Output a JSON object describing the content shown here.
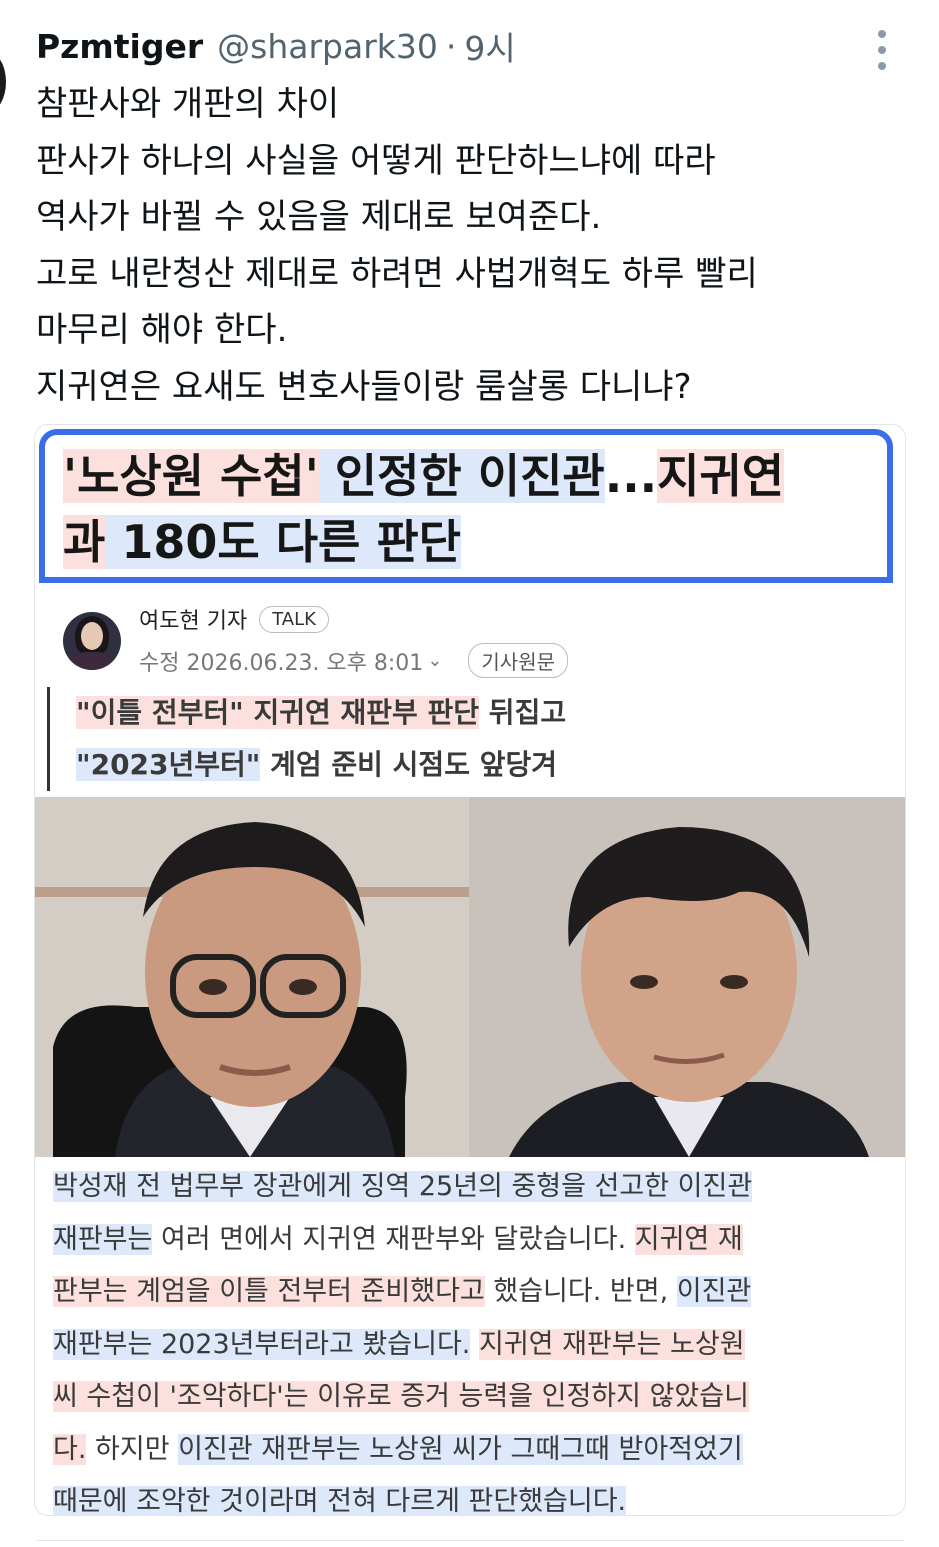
{
  "tweet": {
    "author_name": "Pzmtiger",
    "author_handle": "@sharpark30",
    "separator": "·",
    "time": "9시",
    "lines": [
      "참판사와 개판의 차이",
      "판사가 하나의 사실을 어떻게 판단하느냐에 따라",
      "역사가 바뀔 수 있음을 제대로 보여준다.",
      "고로 내란청산 제대로 하려면 사법개혁도 하루 빨리",
      "마무리 해야 한다.",
      "지귀연은 요새도 변호사들이랑 룸살롱 다니냐?"
    ]
  },
  "article": {
    "headline": {
      "line1_part1": "'노상원 수첩'",
      "line1_part2": " 인정한 이진관",
      "line1_part3": "...",
      "line1_part4": "지귀연",
      "line2_part1": "과",
      "line2_part2": " 180도 다른 판단"
    },
    "reporter": {
      "name": "여도현 기자",
      "talk_label": "TALK",
      "date_label": "수정 2026.06.23. 오후 8:01",
      "chevron": "⌄",
      "original_label": "기사원문"
    },
    "subhead": {
      "line1_highlight": "\"이틀 전부터\" 지귀연 재판부 판단",
      "line1_rest": " 뒤집고",
      "line2_highlight": "\"2023년부터\"",
      "line2_rest": " 계엄 준비 시점도 앞당겨"
    },
    "body": [
      {
        "a": "박성재 전 법무부 장관에게 징역 25년의 중형을 선고한 이진관",
        "b": "",
        "c": ""
      },
      {
        "a": "재판부는",
        "b": " 여러 면에서 지귀연 재판부와 달랐습니다. ",
        "c": "지귀연 재"
      },
      {
        "a": "판부는 계엄을 이틀 전부터 준비했다고",
        "b": " 했습니다. 반면, ",
        "c": "이진관"
      },
      {
        "a": "재판부는 2023년부터라고 봤습니다.",
        "b": " ",
        "c": "지귀연 재판부는 노상원"
      },
      {
        "a": "씨 수첩이 '조악하다'는 이유로 증거 능력을 인정하지 않았습니",
        "b": "",
        "c": ""
      },
      {
        "a": "다.",
        "b": " 하지만 ",
        "c": "이진관 재판부는 노상원 씨가 그때그때 받아적었기"
      },
      {
        "a": "때문에 조악한 것이라며 전혀 다르게 판단했습니다.",
        "b": "",
        "c": ""
      }
    ]
  },
  "colors": {
    "highlight_red": "#fbe0dd",
    "highlight_blue": "#dde8fb",
    "headline_border": "#3a6ee8"
  }
}
